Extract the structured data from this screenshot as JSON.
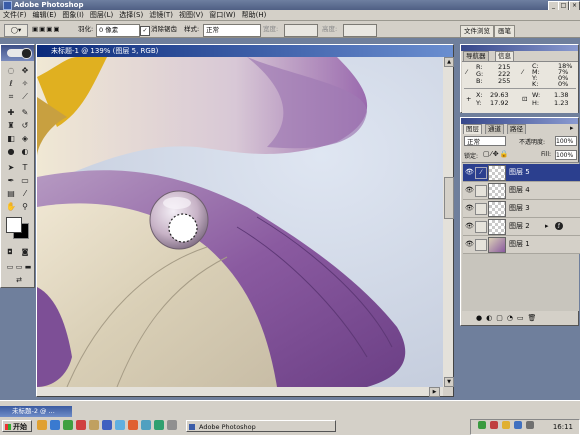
{
  "app": {
    "title": "Adobe Photoshop"
  },
  "menu": [
    "文件(F)",
    "编辑(E)",
    "图象(I)",
    "图层(L)",
    "选择(S)",
    "滤镜(T)",
    "视图(V)",
    "窗口(W)",
    "帮助(H)"
  ],
  "options": {
    "feather_label": "羽化:",
    "feather_value": "0 像素",
    "antialias_label": "消除锯齿",
    "style_label": "样式:",
    "style_value": "正常",
    "width_label": "宽度:",
    "height_label": "高度:"
  },
  "palette_well": {
    "tabs": [
      "文件浏览",
      "画笔"
    ]
  },
  "document": {
    "title": "未标题-1 @ 139% (图层 5, RGB)"
  },
  "info_panel": {
    "tabs": [
      "导航器",
      "信息"
    ],
    "r_label": "R:",
    "r": "215",
    "g_label": "G:",
    "g": "222",
    "b_label": "B:",
    "b": "255",
    "c_label": "C:",
    "c": "18%",
    "m_label": "M:",
    "m": "7%",
    "y_label": "Y:",
    "y": "0%",
    "k_label": "K:",
    "k": "0%",
    "x_label": "X:",
    "x": "29.63",
    "y2_label": "Y:",
    "y2": "17.92",
    "w_label": "W:",
    "w": "1.38",
    "h_label": "H:",
    "h": "1.23"
  },
  "layers_panel": {
    "tabs": [
      "图层",
      "通道",
      "路径"
    ],
    "blend_mode": "正常",
    "opacity_label": "不透明度:",
    "opacity": "100%",
    "lock_label": "锁定:",
    "fill_label": "Fill:",
    "fill": "100%",
    "layers": [
      {
        "name": "图层 5"
      },
      {
        "name": "图层 4"
      },
      {
        "name": "图层 3"
      },
      {
        "name": "图层 2"
      },
      {
        "name": "图层 1"
      }
    ]
  },
  "taskbar": {
    "start_label": "开始",
    "doc_tab": "未标题-2 @ ...",
    "task_label": "Adobe Photoshop",
    "clock": "16:11"
  },
  "colors": {
    "titlebar": "#4f5f84",
    "selected_layer": "#2b3f8e",
    "petal_purple": "#8a5aa0",
    "background": "#cfd6e4"
  }
}
